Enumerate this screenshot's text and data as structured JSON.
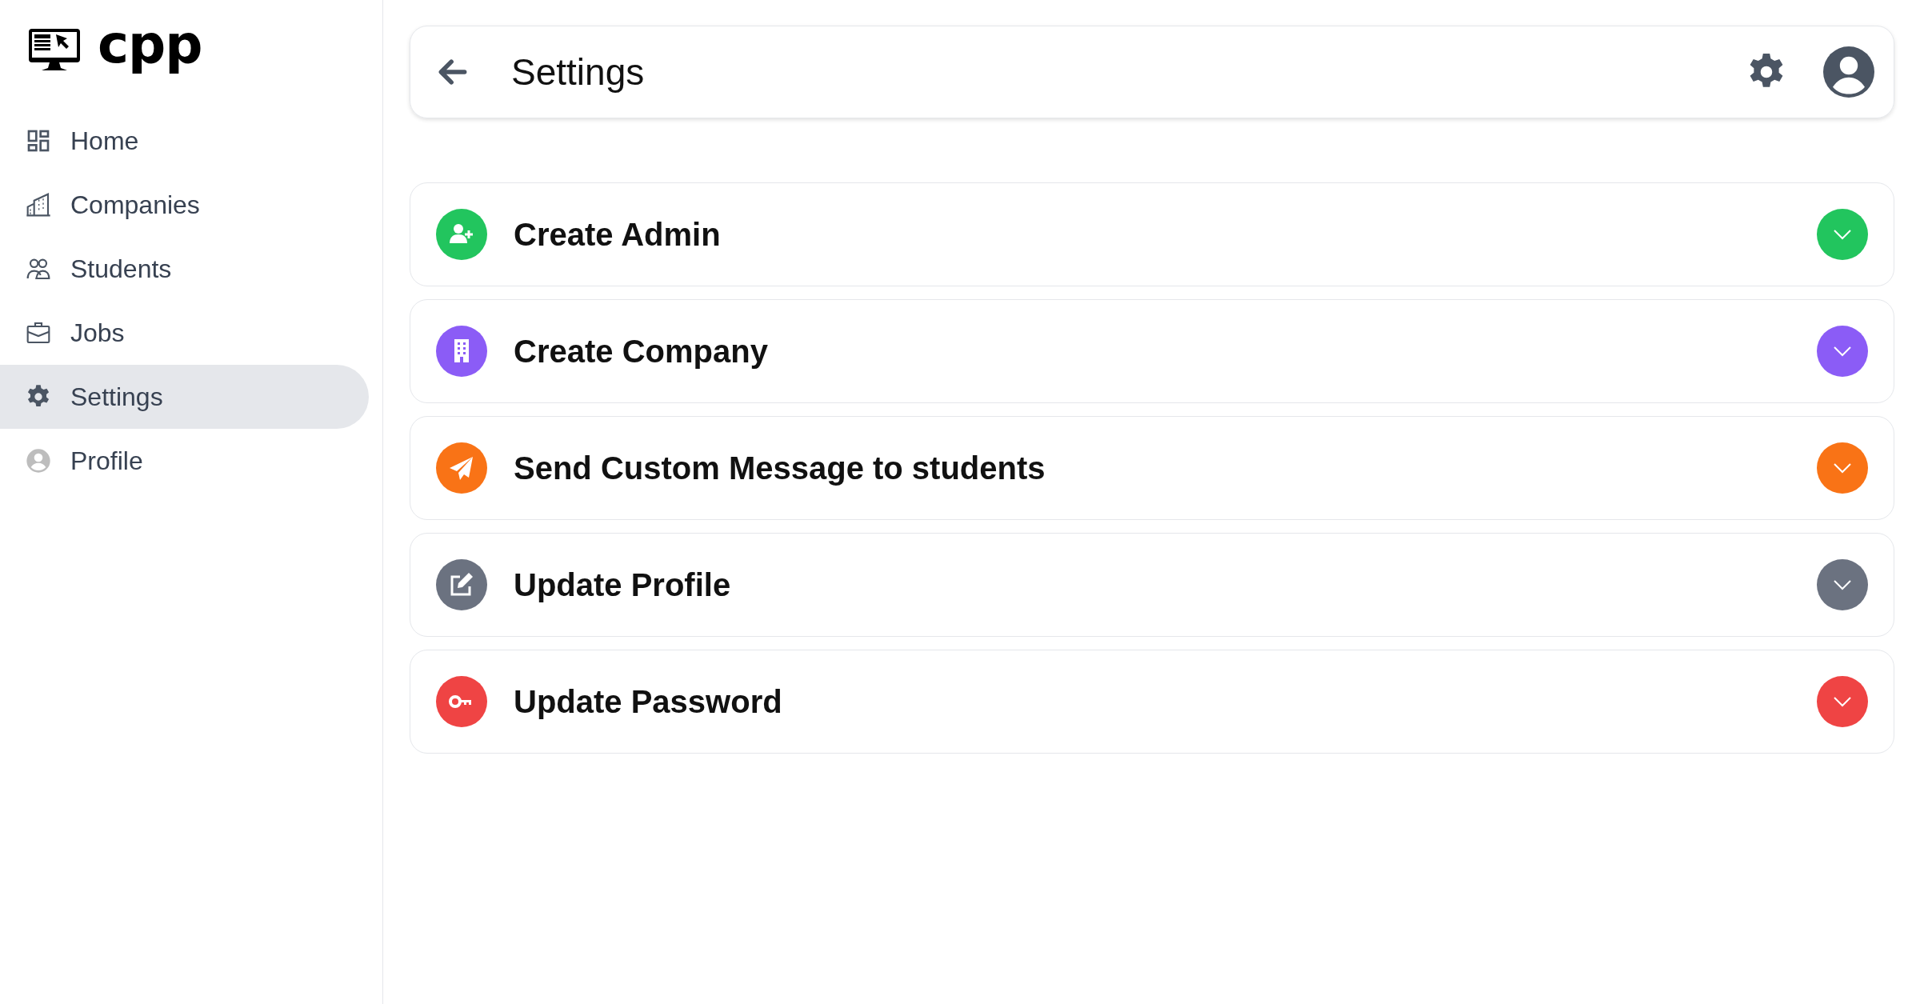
{
  "logo": {
    "text": "cpp"
  },
  "sidebar": {
    "items": [
      {
        "label": "Home",
        "kind": "home",
        "selected": false
      },
      {
        "label": "Companies",
        "kind": "companies",
        "selected": false
      },
      {
        "label": "Students",
        "kind": "students",
        "selected": false
      },
      {
        "label": "Jobs",
        "kind": "jobs",
        "selected": false
      },
      {
        "label": "Settings",
        "kind": "settings",
        "selected": true
      },
      {
        "label": "Profile",
        "kind": "profile",
        "selected": false
      }
    ]
  },
  "header": {
    "title": "Settings"
  },
  "sections": [
    {
      "title": "Create Admin",
      "kind": "admin",
      "color": "#22c55e"
    },
    {
      "title": "Create Company",
      "kind": "company",
      "color": "#8b5cf6"
    },
    {
      "title": "Send Custom Message to students",
      "kind": "message",
      "color": "#f97316"
    },
    {
      "title": "Update Profile",
      "kind": "profile",
      "color": "#6b7280"
    },
    {
      "title": "Update Password",
      "kind": "password",
      "color": "#ef4444"
    }
  ]
}
